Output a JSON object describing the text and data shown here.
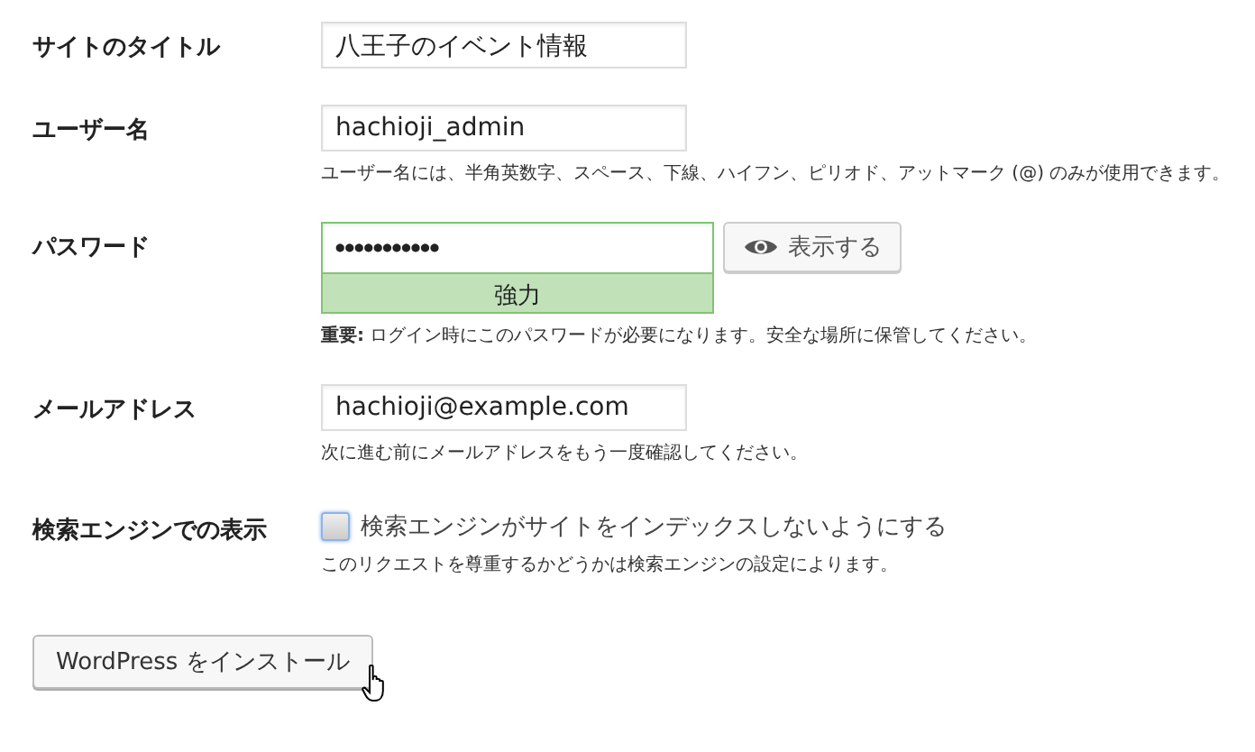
{
  "fields": [
    {
      "kind": "text",
      "label": "サイトのタイトル",
      "value": "八王子のイベント情報"
    },
    {
      "kind": "text",
      "label": "ユーザー名",
      "value": "hachioji_admin",
      "hint": "ユーザー名には、半角英数字、スペース、下線、ハイフン、ピリオド、アットマーク (@) のみが使用できます。"
    },
    {
      "kind": "password",
      "label": "パスワード",
      "value": "●●●●●●●●●●●",
      "strength": "強力",
      "show_button": "表示する",
      "hint": "**重要:** ログイン時にこのパスワードが必要になります。安全な場所に保管してください。"
    },
    {
      "kind": "text",
      "label": "メールアドレス",
      "value": "hachioji@example.com",
      "hint": "次に進む前にメールアドレスをもう一度確認してください。"
    },
    {
      "kind": "checkbox",
      "label": "検索エンジンでの表示",
      "checkbox_label": "検索エンジンがサイトをインデックスしないようにする",
      "checked": false,
      "hint": "このリクエストを尊重するかどうかは検索エンジンの設定によります。"
    }
  ],
  "submit": "WordPress をインストール"
}
